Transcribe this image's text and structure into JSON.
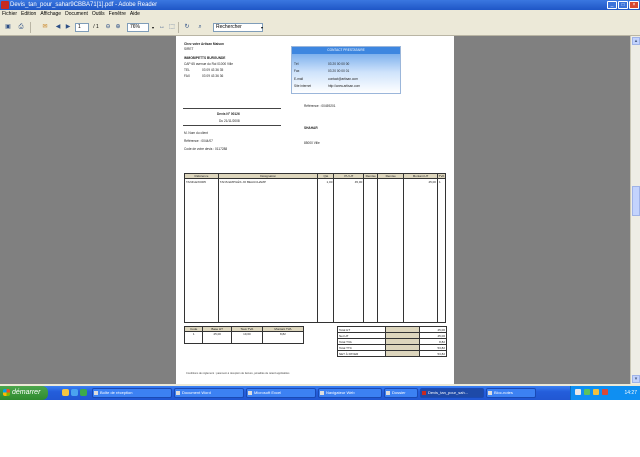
{
  "window": {
    "title": "Devis_tan_pour_sahar9CBBA71[1].pdf - Adobe Reader",
    "minimize": "_",
    "maximize": "□",
    "close": "×"
  },
  "menu": [
    "Fichier",
    "Edition",
    "Affichage",
    "Document",
    "Outils",
    "Fenêtre",
    "Aide"
  ],
  "toolbar": {
    "page_current": "1",
    "page_total": "/ 1",
    "zoom": "76%",
    "find_placeholder": "Rechercher"
  },
  "document": {
    "company": "Chez votre Artisan Maison",
    "company_line2": "SIRET",
    "company_name": "IMMOBIPETTS BURGUNDE",
    "address": "CAP 65 avenue du Roi 01000 Ville",
    "tel_label": "TEL",
    "tel_value": "03 09 43 36 35",
    "fax_label": "FAX",
    "fax_value": "03 09 43 36 36",
    "contact_box_title": "CONTACT PRESTATAIRE",
    "contact_rows": [
      {
        "label": "Tél",
        "value": "03 20 00 00 00"
      },
      {
        "label": "Fax",
        "value": "03 20 00 00 01"
      },
      {
        "label": "E-mail",
        "value": "contact@artisan.com"
      },
      {
        "label": "Site internet",
        "value": "http://www.artisan.com"
      }
    ],
    "invoice_title": "Devis N° 00126",
    "invoice_date": "Du 21/11/2008",
    "client_ref": "Référence : 00459201",
    "client_label": "SHAHAR",
    "client_city": "85000 Ville",
    "client_lines": [
      "M. Nom du client",
      "Référence : 0044/07",
      "Code de votre devis : 0117288"
    ],
    "table_headers": [
      "Référence",
      "Désignation",
      "Qté",
      "PU HT",
      "Remise",
      "Montant HT",
      "TVA"
    ],
    "table_row": [
      "TANFLEX0005",
      "TANS EMPILÉS JO BEAUCHAMP",
      "1,00",
      "45,00",
      "",
      "45,00",
      "1"
    ],
    "tva_headers": [
      "Code",
      "Base HT",
      "Taux TVA",
      "Montant TVA"
    ],
    "tva_row": [
      "1",
      "45,00",
      "19,60",
      "8,82"
    ],
    "totals": [
      {
        "label": "Total HT",
        "value": "45,00"
      },
      {
        "label": "Net HT",
        "value": "45,00"
      },
      {
        "label": "Total TVA",
        "value": "8,82"
      },
      {
        "label": "Total TTC",
        "value": "53,82"
      },
      {
        "label": "NET À PAYER",
        "value": "53,82"
      }
    ],
    "footer": "Conditions de règlement : paiement à réception de facture, pénalités de retard applicables"
  },
  "taskbar": {
    "start_label": "démarrer",
    "tasks": [
      "Boîte de réception",
      "Document Word",
      "Microsoft Excel",
      "Navigateur Web",
      "Dossier",
      "Devis_tan_pour_sah...",
      "Bloc-notes"
    ],
    "active_task_index": 5,
    "clock": "14:27"
  },
  "colors": {
    "titlebar": "#245edb",
    "taskbar": "#245edb",
    "start": "#3c9c3c",
    "doc_bg": "#808080",
    "contact_header": "#3d86e0"
  }
}
